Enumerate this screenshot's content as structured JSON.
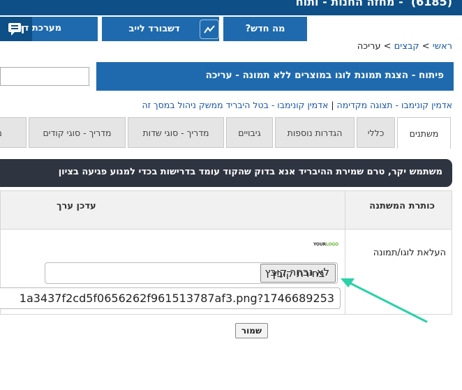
{
  "header": {
    "title": "(6185) ​ - מחזה החנות - ותוח",
    "whats_new": "מה חדש?",
    "dashboard": "דשבורד לייב",
    "system": "מערכת די"
  },
  "breadcrumb": {
    "home": "ראשי",
    "sep1": " > ",
    "files": "קבצים",
    "sep2": " > ",
    "current": "עריכה"
  },
  "page_title": "פיתוח - הצגת תמונת לוגו במוצרים ללא תמונה - עריכה",
  "admin_links": {
    "link1": "אדמין קונימבו - תצוגה מקדימה",
    "sep": " | ",
    "link2": "אדמין קונימבו - בטל היבריד ממשק ניהול במסך זה"
  },
  "tabs": [
    "משתנים",
    "כללי",
    "הגדרות נוספות",
    "גיבויים",
    "מדריך - סוגי שדות",
    "מדריך - סוגי קודים",
    "מדריך"
  ],
  "notice": "משתמש יקר, טרם שמירת ההיבריד אנא בדוק שהקוד עומד בדרישות בכדי למנוע פגיעה בציון",
  "table": {
    "col_var": "כותרת המשתנה",
    "col_val": "עדכן ערך",
    "row_label": "העלאת לוגו/תמונה",
    "logo_text_a": "YOUR",
    "logo_text_b": "LOGO",
    "file_button": "בחירת קובץ",
    "file_status": "לא נבחר קובץ",
    "url_value": "1a3437f2cd5f0656262f961513787af3.png?1746689253"
  },
  "save_label": "שמור",
  "colors": {
    "nav_dark": "#0d4f86",
    "nav": "#1f6aae",
    "link": "#1a57a8",
    "notice_bg": "#2e3440",
    "arrow": "#2bd1a7"
  }
}
